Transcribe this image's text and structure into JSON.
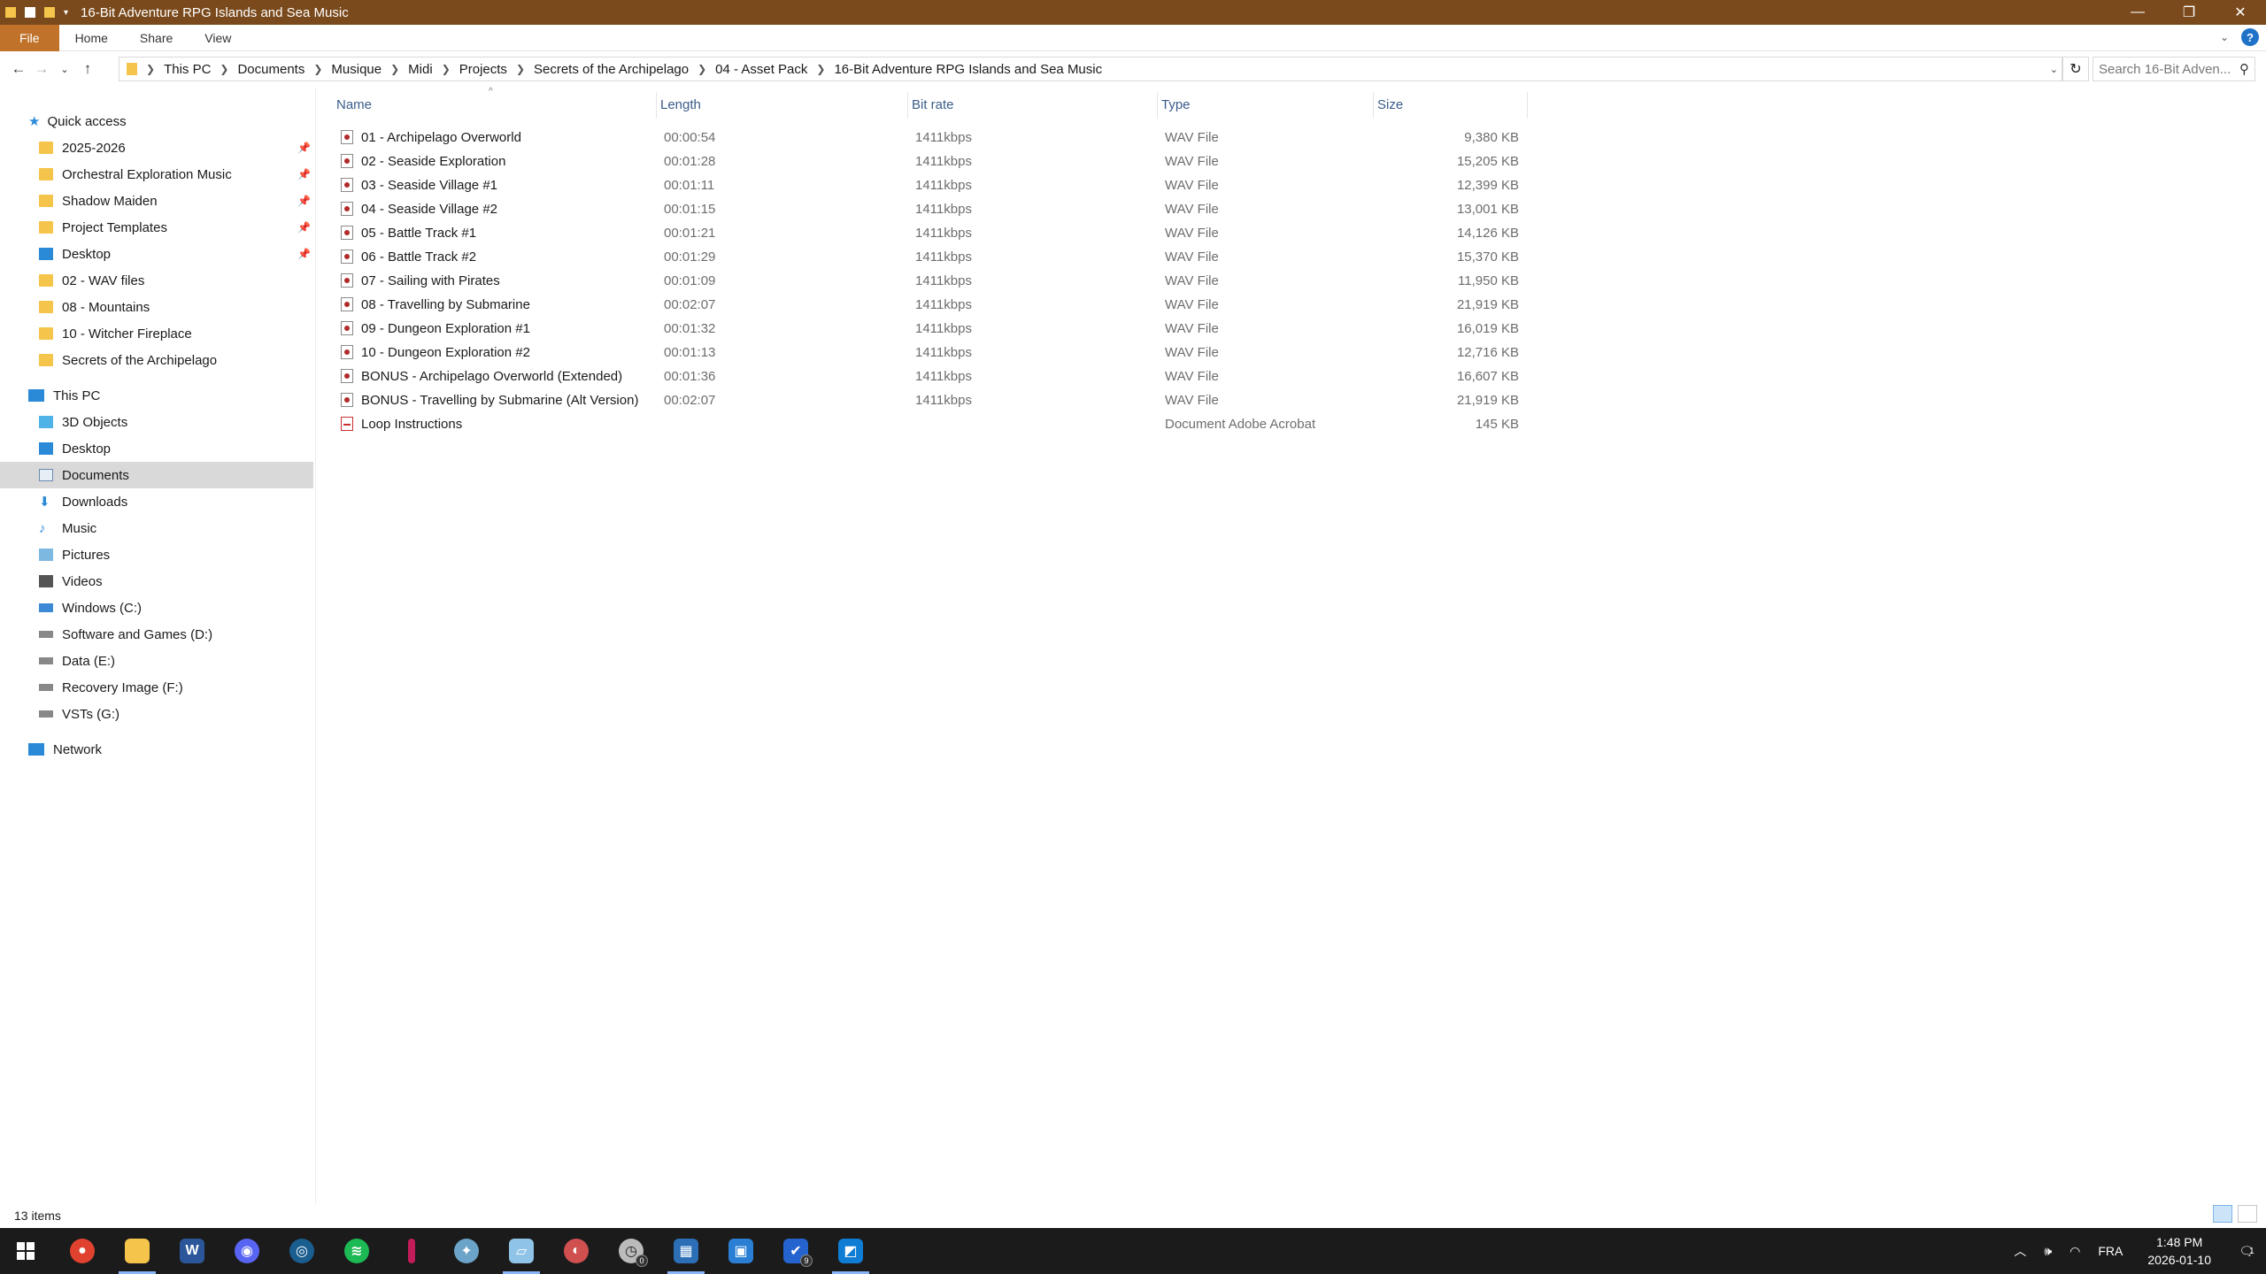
{
  "window": {
    "title": "16-Bit Adventure RPG Islands and Sea Music",
    "controls": [
      "—",
      "❐",
      "✕"
    ]
  },
  "ribbon": {
    "tabs": [
      "File",
      "Home",
      "Share",
      "View"
    ],
    "help": "?"
  },
  "address": {
    "breadcrumb": [
      "This PC",
      "Documents",
      "Musique",
      "Midi",
      "Projects",
      "Secrets of the Archipelago",
      "04 - Asset Pack",
      "16-Bit Adventure RPG Islands and Sea Music"
    ],
    "search_placeholder": "Search 16-Bit Adven..."
  },
  "nav": {
    "quick_access_label": "Quick access",
    "quick_access": [
      {
        "label": "2025-2026",
        "pinned": true,
        "icon": "folder-icon"
      },
      {
        "label": "Orchestral Exploration Music",
        "pinned": true,
        "icon": "folder-icon"
      },
      {
        "label": "Shadow Maiden",
        "pinned": true,
        "icon": "folder-icon"
      },
      {
        "label": "Project Templates",
        "pinned": true,
        "icon": "folder-icon"
      },
      {
        "label": "Desktop",
        "pinned": true,
        "icon": "desktop-icon"
      },
      {
        "label": "02 - WAV files",
        "pinned": false,
        "icon": "folder-icon"
      },
      {
        "label": "08 - Mountains",
        "pinned": false,
        "icon": "folder-icon"
      },
      {
        "label": "10 - Witcher Fireplace",
        "pinned": false,
        "icon": "folder-icon"
      },
      {
        "label": "Secrets of the Archipelago",
        "pinned": false,
        "icon": "folder-icon"
      }
    ],
    "this_pc_label": "This PC",
    "this_pc": [
      {
        "label": "3D Objects",
        "icon": "3d-objects-icon"
      },
      {
        "label": "Desktop",
        "icon": "desktop-icon"
      },
      {
        "label": "Documents",
        "icon": "documents-icon",
        "selected": true
      },
      {
        "label": "Downloads",
        "icon": "downloads-icon"
      },
      {
        "label": "Music",
        "icon": "music-icon"
      },
      {
        "label": "Pictures",
        "icon": "pictures-icon"
      },
      {
        "label": "Videos",
        "icon": "videos-icon"
      },
      {
        "label": "Windows (C:)",
        "icon": "drive-icon"
      },
      {
        "label": "Software and Games (D:)",
        "icon": "drive-icon"
      },
      {
        "label": "Data (E:)",
        "icon": "drive-icon"
      },
      {
        "label": "Recovery Image (F:)",
        "icon": "drive-icon"
      },
      {
        "label": "VSTs (G:)",
        "icon": "drive-icon"
      }
    ],
    "network_label": "Network"
  },
  "columns": [
    "Name",
    "Length",
    "Bit rate",
    "Type",
    "Size"
  ],
  "files": [
    {
      "name": "01 - Archipelago Overworld",
      "length": "00:00:54",
      "bitrate": "1411kbps",
      "type": "WAV File",
      "size": "9,380 KB"
    },
    {
      "name": "02 - Seaside Exploration",
      "length": "00:01:28",
      "bitrate": "1411kbps",
      "type": "WAV File",
      "size": "15,205 KB"
    },
    {
      "name": "03 - Seaside Village #1",
      "length": "00:01:11",
      "bitrate": "1411kbps",
      "type": "WAV File",
      "size": "12,399 KB"
    },
    {
      "name": "04 - Seaside Village #2",
      "length": "00:01:15",
      "bitrate": "1411kbps",
      "type": "WAV File",
      "size": "13,001 KB"
    },
    {
      "name": "05 - Battle Track #1",
      "length": "00:01:21",
      "bitrate": "1411kbps",
      "type": "WAV File",
      "size": "14,126 KB"
    },
    {
      "name": "06 - Battle Track #2",
      "length": "00:01:29",
      "bitrate": "1411kbps",
      "type": "WAV File",
      "size": "15,370 KB"
    },
    {
      "name": "07 - Sailing with Pirates",
      "length": "00:01:09",
      "bitrate": "1411kbps",
      "type": "WAV File",
      "size": "11,950 KB"
    },
    {
      "name": "08 - Travelling by Submarine",
      "length": "00:02:07",
      "bitrate": "1411kbps",
      "type": "WAV File",
      "size": "21,919 KB"
    },
    {
      "name": "09 - Dungeon Exploration #1",
      "length": "00:01:32",
      "bitrate": "1411kbps",
      "type": "WAV File",
      "size": "16,019 KB"
    },
    {
      "name": "10 - Dungeon Exploration #2",
      "length": "00:01:13",
      "bitrate": "1411kbps",
      "type": "WAV File",
      "size": "12,716 KB"
    },
    {
      "name": "BONUS - Archipelago Overworld (Extended)",
      "length": "00:01:36",
      "bitrate": "1411kbps",
      "type": "WAV File",
      "size": "16,607 KB"
    },
    {
      "name": "BONUS - Travelling by Submarine (Alt Version)",
      "length": "00:02:07",
      "bitrate": "1411kbps",
      "type": "WAV File",
      "size": "21,919 KB"
    },
    {
      "name": "Loop Instructions",
      "length": "",
      "bitrate": "",
      "type": "Document Adobe Acrobat",
      "size": "145 KB"
    }
  ],
  "status": {
    "items": "13 items"
  },
  "taskbar": {
    "apps": [
      "chrome-icon",
      "file-explorer-icon",
      "word-icon",
      "discord-icon",
      "steam-icon",
      "spotify-icon",
      "app-icon",
      "app-icon",
      "app-icon",
      "app-icon",
      "clock-app-icon",
      "calculator-icon",
      "calendar-icon",
      "todo-icon",
      "photos-icon"
    ],
    "badges": {
      "clock_app": "0",
      "todo": "9"
    },
    "lang": "FRA",
    "time": "1:48 PM",
    "date": "2026-01-10",
    "notifications": "1"
  },
  "colors": {
    "titlebar": "#7a4a1c",
    "file_tab": "#c0722a",
    "taskbar": "#1b1b1b",
    "selection": "#d9d9d9"
  }
}
